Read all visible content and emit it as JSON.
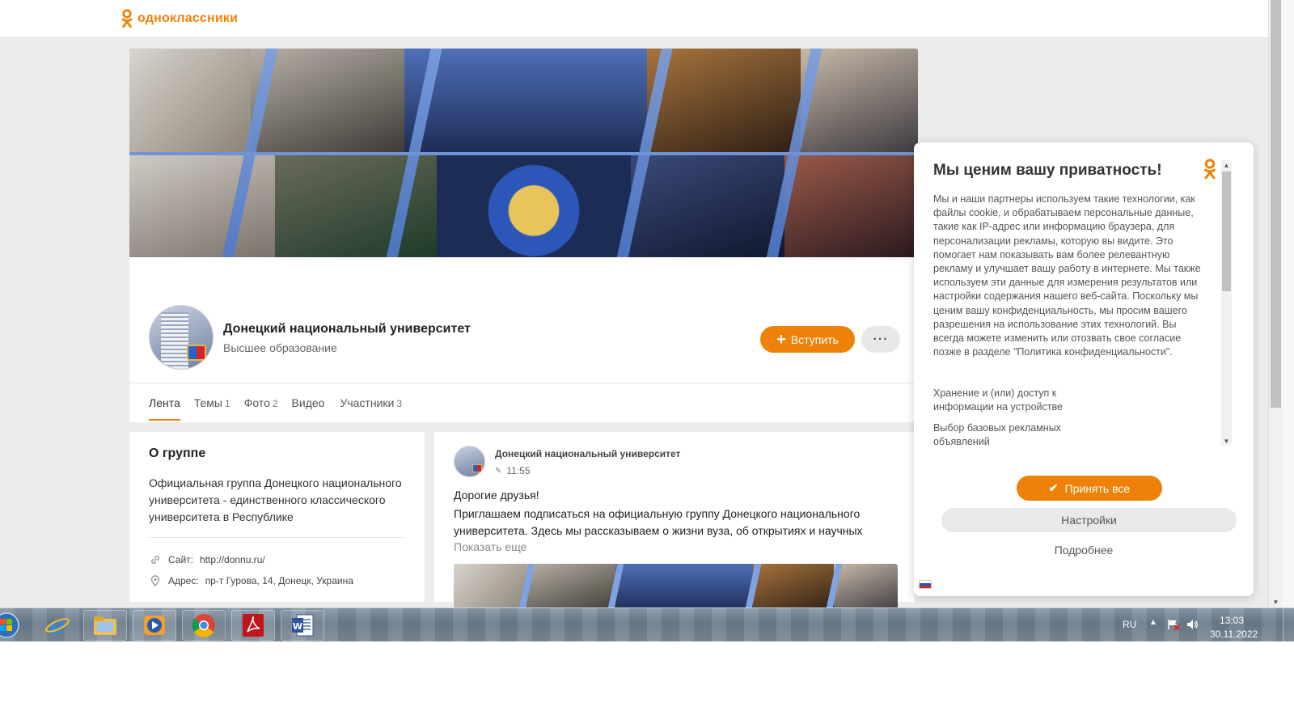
{
  "site": {
    "logo_text": "одноклассники",
    "brand_color": "#ee8208"
  },
  "group": {
    "name": "Донецкий национальный университет",
    "category": "Высшее образование",
    "join_label": "Вступить",
    "more_label": "···",
    "tabs": [
      {
        "label": "Лента",
        "count": ""
      },
      {
        "label": "Темы",
        "count": "1"
      },
      {
        "label": "Фото",
        "count": "2"
      },
      {
        "label": "Видео",
        "count": ""
      },
      {
        "label": "Участники",
        "count": "3"
      }
    ]
  },
  "about": {
    "title": "О группе",
    "description": "Официальная группа Донецкого национального университета - единственного классического университета в Республике",
    "site_label": "Сайт:",
    "site_value": "http://donnu.ru/",
    "address_label": "Адрес:",
    "address_value": "пр-т Гурова, 14, Донецк, Украина"
  },
  "post": {
    "author": "Донецкий национальный университет",
    "time": "11:55",
    "greeting": "Дорогие друзья!",
    "text": "Приглашаем подписаться на официальную группу Донецкого национального университета. Здесь мы рассказываем о жизни вуза, об открытиях и научных",
    "show_more": "Показать еще"
  },
  "privacy": {
    "title": "Мы ценим вашу приватность!",
    "body": "Мы и наши партнеры используем такие технологии, как файлы cookie, и обрабатываем персональные данные, такие как IP-адрес или информацию браузера, для персонализации рекламы, которую вы видите. Это помогает нам показывать вам более релевантную рекламу и улучшает вашу работу в интернете. Мы также используем эти данные для измерения результатов или настройки содержания нашего веб-сайта. Поскольку мы ценим вашу конфиденциальность, мы просим вашего разрешения на использование этих технологий. Вы всегда можете изменить или отозвать свое согласие позже в разделе \"Политика конфиденциальности\".",
    "storage_text": "Хранение и (или) доступ к информации на устройстве",
    "ads_text": "Выбор базовых рекламных объявлений",
    "accept_label": "Принять все",
    "settings_label": "Настройки",
    "details_label": "Подробнее"
  },
  "taskbar": {
    "apps": [
      "internet-explorer",
      "file-explorer",
      "media-player",
      "chrome",
      "acrobat-reader",
      "word"
    ],
    "lang": "RU",
    "time": "13:03",
    "date": "30.11.2022"
  }
}
